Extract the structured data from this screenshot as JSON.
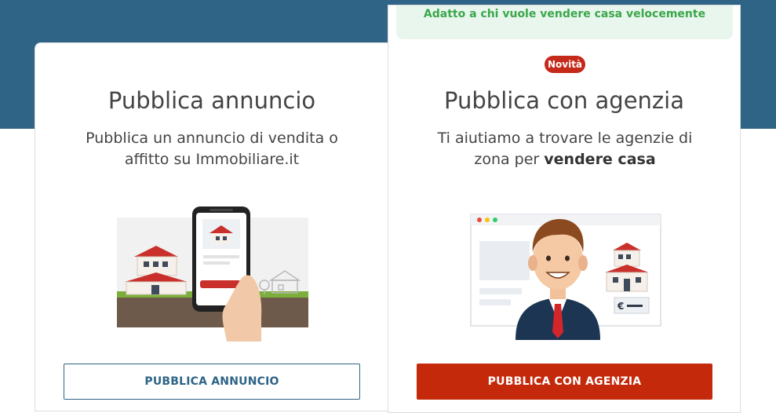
{
  "colors": {
    "header_band": "#2f6486",
    "accent_red": "#c5290c",
    "primary_blue": "#2f6486",
    "banner_bg": "#e9f6ee",
    "banner_text": "#3aa74a"
  },
  "left_card": {
    "title": "Pubblica annuncio",
    "desc_line1": "Pubblica un annuncio di vendita o",
    "desc_line2": "affitto su Immobiliare.it",
    "illustration": "house-and-smartphone-illustration",
    "button_label": "PUBBLICA ANNUNCIO"
  },
  "right_card": {
    "banner": "Adatto a chi vuole vendere casa velocemente",
    "badge": "Novità",
    "title": "Pubblica con agenzia",
    "desc_line1": "Ti aiutiamo a trovare le agenzie di",
    "desc_line2_prefix": "zona per ",
    "desc_line2_bold": "vendere casa",
    "illustration": "agent-and-browser-illustration",
    "price_tag": "€",
    "button_label": "PUBBLICA CON AGENZIA"
  }
}
